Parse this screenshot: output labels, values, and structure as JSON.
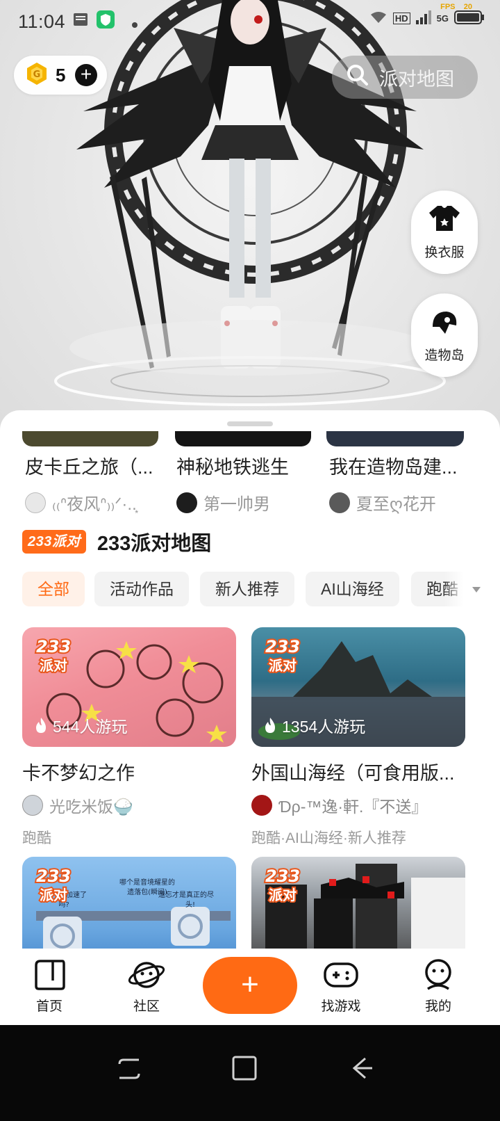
{
  "status_bar": {
    "time": "11:04",
    "fps_label": "FPS",
    "fps_value": "20",
    "network": "5G",
    "hd": "HD"
  },
  "hero": {
    "coin_count": "5",
    "search_label": "派对地图",
    "side_buttons": [
      {
        "label": "换衣服",
        "icon": "shirt-icon"
      },
      {
        "label": "造物岛",
        "icon": "island-icon"
      }
    ]
  },
  "top_games": [
    {
      "title": "皮卡丘之旅（...",
      "author": "₍₍ᐢ夜风ᐢ₎₎ᐟ·..͙"
    },
    {
      "title": "神秘地铁逃生",
      "author": "第一帅男"
    },
    {
      "title": "我在造物岛建...",
      "author": "夏至ღ花开"
    }
  ],
  "party_section": {
    "badge": "233派对",
    "title": "233派对地图",
    "chips": [
      "全部",
      "活动作品",
      "新人推荐",
      "AI山海经",
      "跑酷"
    ],
    "active_chip": "全部"
  },
  "cards": [
    {
      "plays": "544人游玩",
      "title": "卡不梦幻之作",
      "author": "光吃米饭🍚",
      "tags": "跑酷",
      "badge_top": "233",
      "badge_bottom": "派对"
    },
    {
      "plays": "1354人游玩",
      "title": "外国山海经（可食用版...",
      "author": "Ɗρ-™逸·軒.『不送』",
      "tags": "跑酷·AI山海经·新人推荐",
      "badge_top": "233",
      "badge_bottom": "派对"
    },
    {
      "badge_top": "233",
      "badge_bottom": "派对",
      "caption_a": "哪个是音境耀星的",
      "caption_b": "遗落包(瞬间)",
      "caption_c": "加速了",
      "caption_d": "吗?",
      "caption_e": "還忘才是真正的尽",
      "caption_f": "头!"
    },
    {
      "badge_top": "233",
      "badge_bottom": "派对"
    }
  ],
  "bottom_nav": [
    {
      "label": "首页",
      "icon": "home-icon"
    },
    {
      "label": "社区",
      "icon": "planet-icon"
    },
    {
      "label": "+",
      "icon": "plus-icon"
    },
    {
      "label": "找游戏",
      "icon": "gamepad-icon"
    },
    {
      "label": "我的",
      "icon": "profile-icon"
    }
  ],
  "colors": {
    "accent": "#ff6a14",
    "chip_active_bg": "#fff1e8",
    "coin_gold": "#f5b400"
  }
}
